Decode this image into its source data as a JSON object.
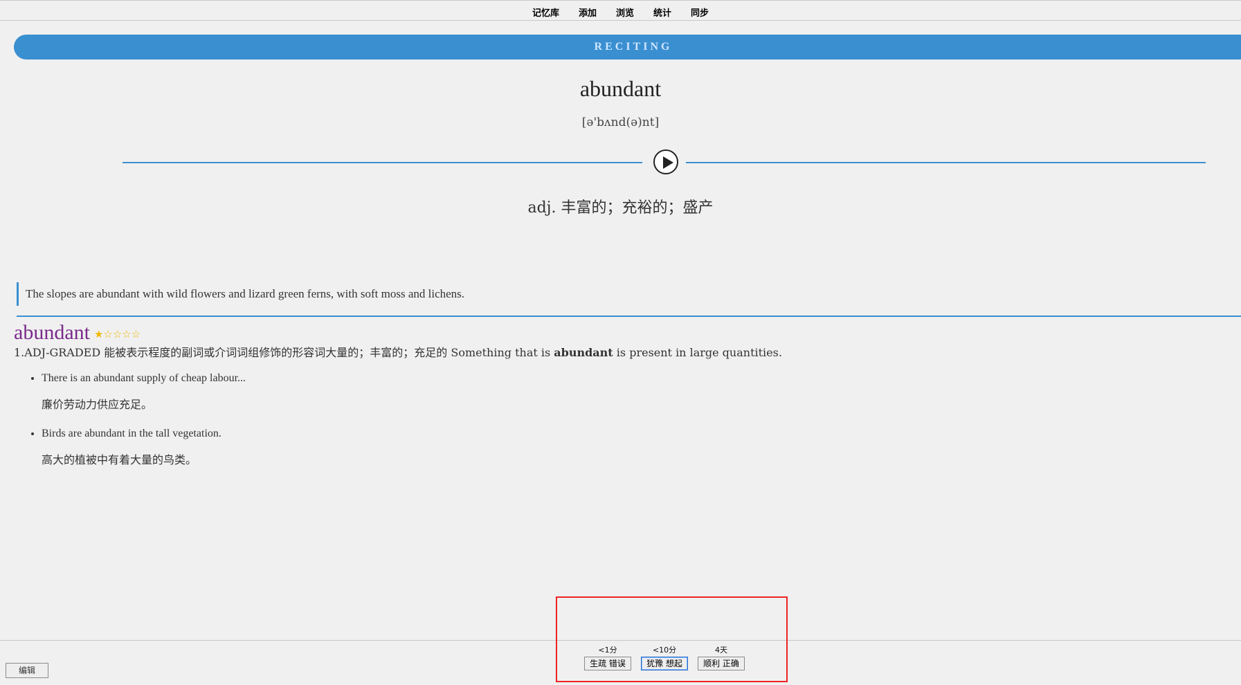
{
  "toolbar": {
    "links": [
      "记忆库",
      "添加",
      "浏览",
      "统计",
      "同步"
    ]
  },
  "card": {
    "banner": "RECITING",
    "word": "abundant",
    "phonetic": "[ə'bʌnd(ə)nt]",
    "meaning": "adj. 丰富的；充裕的；盛产",
    "quote": "The slopes are abundant with wild flowers and lizard green ferns, with soft moss and lichens.",
    "dict": {
      "headword": "abundant",
      "stars": "★☆☆☆☆",
      "sense_prefix": "1.ADJ-GRADED 能被表示程度的副词或介词词组修饰的形容词大量的；丰富的；充足的 Something that is ",
      "sense_bold": "abundant",
      "sense_suffix": " is present in large quantities.",
      "examples": [
        {
          "en": "There is an abundant supply of cheap labour...",
          "cn": "廉价劳动力供应充足。"
        },
        {
          "en": "Birds are abundant in the tall vegetation.",
          "cn": "高大的植被中有着大量的鸟类。"
        }
      ]
    }
  },
  "bottom": {
    "edit": "编辑",
    "answers": [
      {
        "time": "<1分",
        "label": "生疏 错误"
      },
      {
        "time": "<10分",
        "label": "犹豫 想起"
      },
      {
        "time": "4天",
        "label": "顺利 正确"
      }
    ]
  },
  "colors": {
    "accent": "#3a8fd0",
    "headword": "#7a2a8a",
    "star": "#f0b800",
    "highlight": "#e22222"
  }
}
